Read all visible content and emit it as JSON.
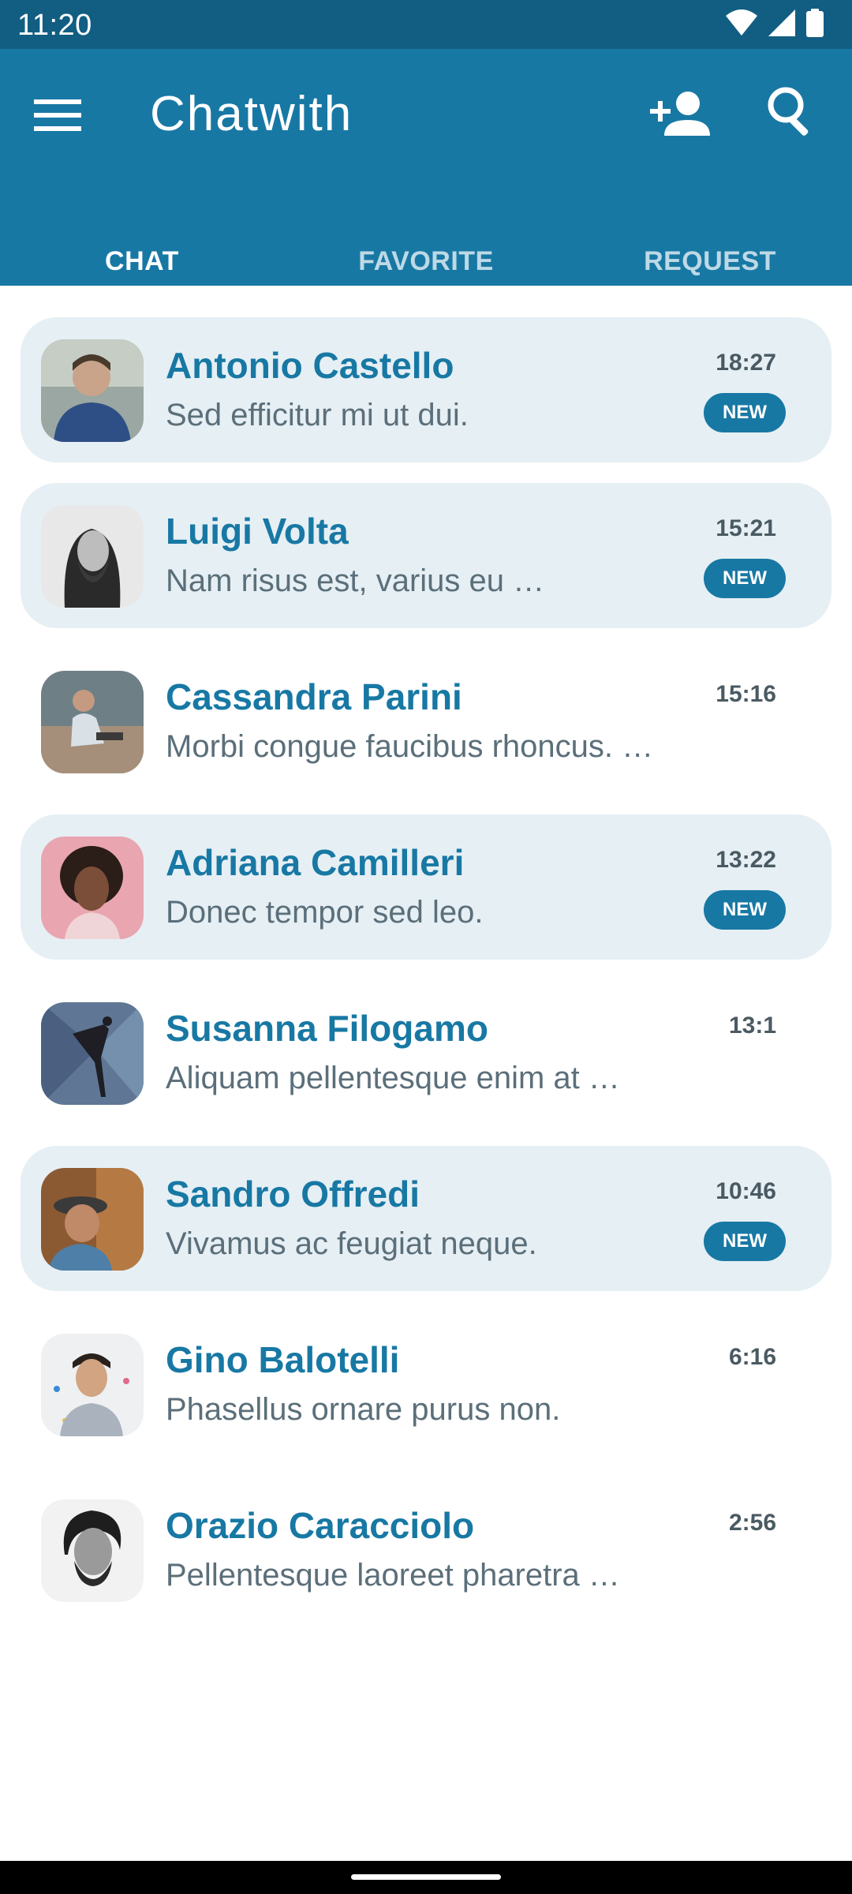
{
  "status_bar": {
    "time": "11:20",
    "icons": [
      "wifi-icon",
      "cellular-signal-icon",
      "battery-icon"
    ]
  },
  "app_bar": {
    "title": "Chatwith",
    "actions": [
      "menu-icon",
      "add-person-icon",
      "search-icon"
    ]
  },
  "tabs": [
    {
      "label": "CHAT",
      "active": true
    },
    {
      "label": "FAVORITE",
      "active": false
    },
    {
      "label": "REQUEST",
      "active": false
    }
  ],
  "chats": [
    {
      "name": "Antonio Castello",
      "preview": "Sed efficitur mi ut dui.",
      "time": "18:27",
      "badge": "NEW",
      "unread": true
    },
    {
      "name": "Luigi Volta",
      "preview": "Nam risus est, varius eu …",
      "time": "15:21",
      "badge": "NEW",
      "unread": true
    },
    {
      "name": "Cassandra Parini",
      "preview": "Morbi congue faucibus rhoncus. …",
      "time": "15:16",
      "badge": null,
      "unread": false
    },
    {
      "name": "Adriana Camilleri",
      "preview": "Donec tempor sed leo.",
      "time": "13:22",
      "badge": "NEW",
      "unread": true
    },
    {
      "name": "Susanna Filogamo",
      "preview": "Aliquam pellentesque enim at …",
      "time": "13:1",
      "badge": null,
      "unread": false
    },
    {
      "name": "Sandro Offredi",
      "preview": "Vivamus ac feugiat neque.",
      "time": "10:46",
      "badge": "NEW",
      "unread": true
    },
    {
      "name": "Gino Balotelli",
      "preview": "Phasellus ornare purus non.",
      "time": "6:16",
      "badge": null,
      "unread": false
    },
    {
      "name": "Orazio Caracciolo",
      "preview": "Pellentesque laoreet pharetra …",
      "time": "2:56",
      "badge": null,
      "unread": false
    }
  ],
  "colors": {
    "primary": "#1878a4",
    "status_bar": "#125e82",
    "unread_row": "#e6eff4",
    "name_text": "#1878a4",
    "preview_text": "#5b6f7a"
  }
}
